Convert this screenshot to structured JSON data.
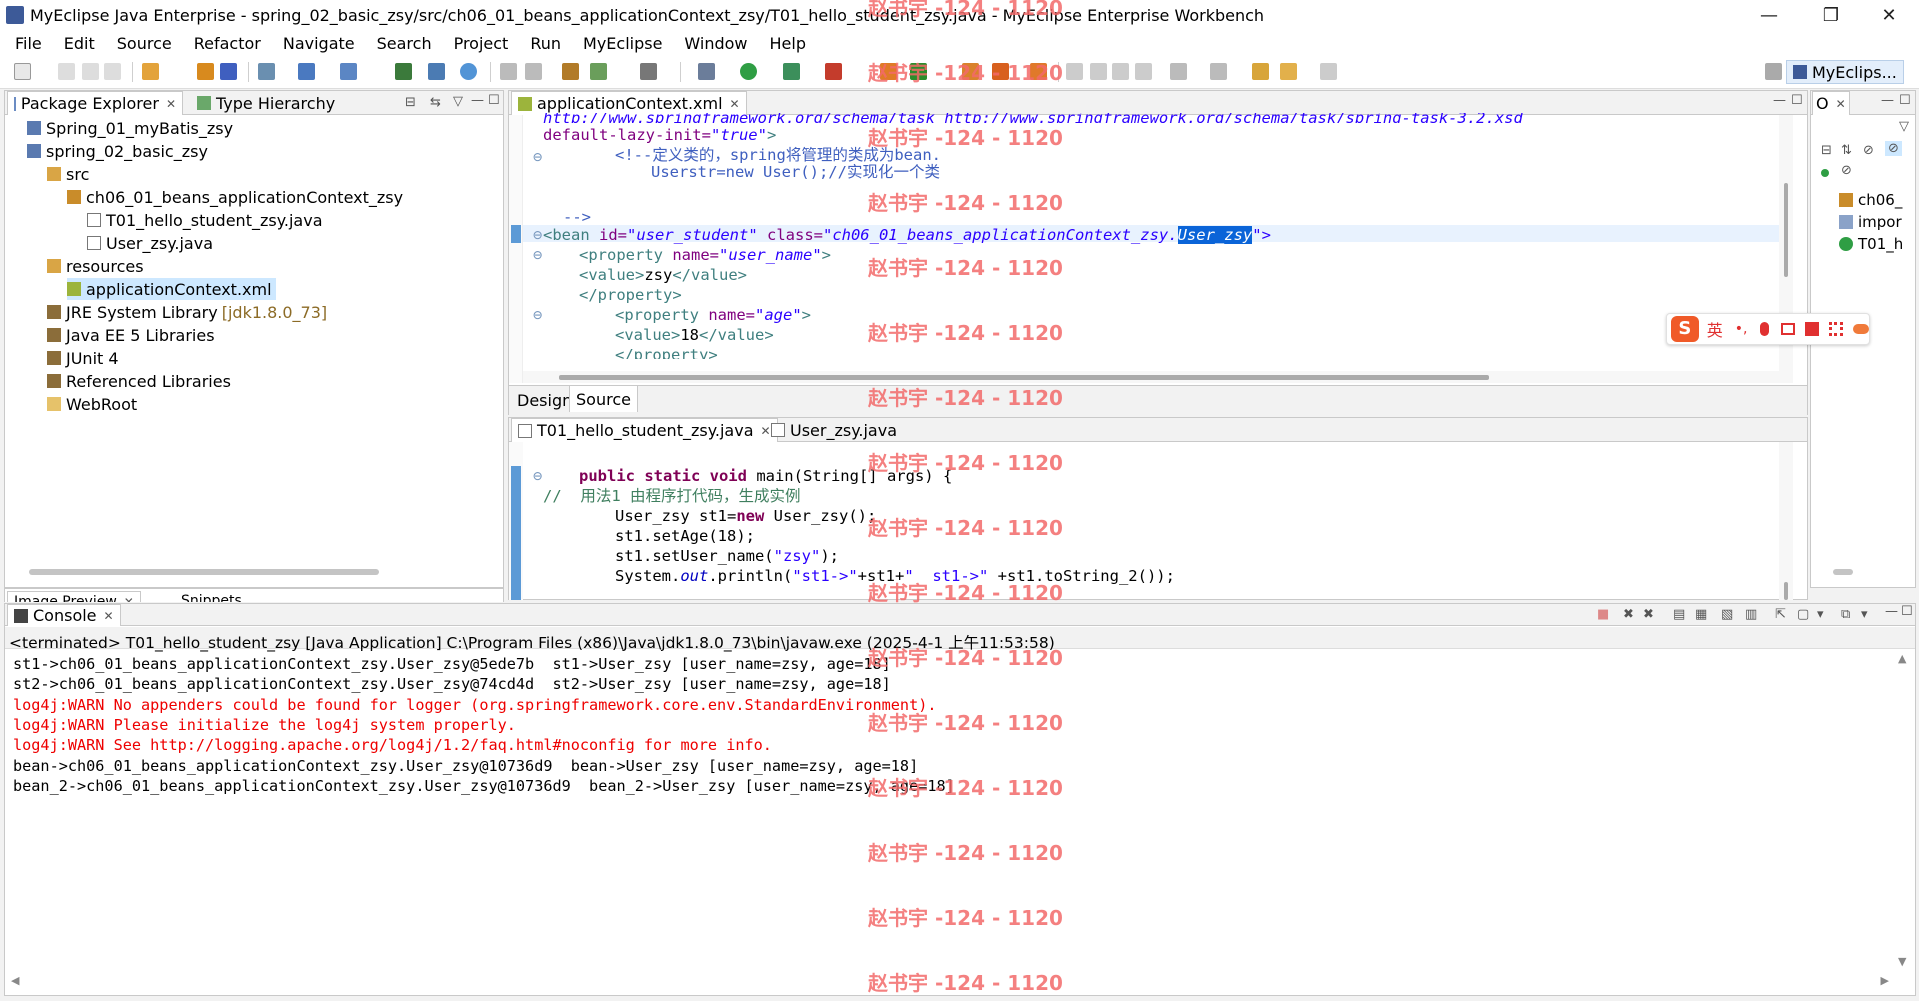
{
  "window": {
    "title": "MyEclipse Java Enterprise - spring_02_basic_zsy/src/ch06_01_beans_applicationContext_zsy/T01_hello_student_zsy.java - MyEclipse Enterprise Workbench",
    "minimize": "—",
    "restore": "❐",
    "close": "✕"
  },
  "menu": [
    "File",
    "Edit",
    "Source",
    "Refactor",
    "Navigate",
    "Search",
    "Project",
    "Run",
    "MyEclipse",
    "Window",
    "Help"
  ],
  "perspective": {
    "label": "MyEclips..."
  },
  "package_explorer": {
    "tab1": "Package Explorer",
    "tab2": "Type Hierarchy",
    "items": [
      {
        "label": "Spring_01_myBatis_zsy"
      },
      {
        "label": "spring_02_basic_zsy"
      },
      {
        "label": "src"
      },
      {
        "label": "ch06_01_beans_applicationContext_zsy"
      },
      {
        "label": "T01_hello_student_zsy.java"
      },
      {
        "label": "User_zsy.java"
      },
      {
        "label": "resources"
      },
      {
        "label": "applicationContext.xml"
      },
      {
        "label": "JRE System Library",
        "extra": "[jdk1.8.0_73]"
      },
      {
        "label": "Java EE 5 Libraries"
      },
      {
        "label": "JUnit 4"
      },
      {
        "label": "Referenced Libraries"
      },
      {
        "label": "WebRoot"
      }
    ]
  },
  "bottom_left_tabs": {
    "tab1": "Image Preview",
    "tab2": "Snippets"
  },
  "xml_editor": {
    "tab": "applicationContext.xml",
    "mode_tabs": [
      "Design",
      "Source"
    ],
    "lines": {
      "l0": "http://www.springframework.org/schema/task http://www.springframework.org/schema/task/spring-task-3.2.xsd",
      "l1a": "default-lazy-init=",
      "l1b": "\"true\"",
      "l1c": ">",
      "l2": "<!--定义类的，spring将管理的类成为bean.",
      "l3": "Userstr=new User();//实现化一个类",
      "l4": "-->",
      "l5a": "<bean",
      "l5b": " id=",
      "l5c": "\"user_student\"",
      "l5d": " class=",
      "l5e": "\"ch06_01_beans_applicationContext_zsy.",
      "l5f": "User_zsy",
      "l5g": "\">",
      "l6a": "<property",
      "l6b": " name=",
      "l6c": "\"user_name\"",
      "l6d": ">",
      "l7a": "<value>",
      "l7b": "zsy",
      "l7c": "</value>",
      "l8": "</property>",
      "l9a": "<property",
      "l9b": " name=",
      "l9c": "\"age\"",
      "l9d": ">",
      "l10a": "<value>",
      "l10b": "18",
      "l10c": "</value>",
      "l11": "</property>"
    }
  },
  "java_editor": {
    "tab1": "T01_hello_student_zsy.java",
    "tab2": "User_zsy.java",
    "lines": {
      "m1a": "public static void",
      "m1b": " main(String[] args) {",
      "m2": "//  用法1 由程序打代码，生成实例",
      "m3a": "User_zsy st1=",
      "m3b": "new",
      "m3c": " User_zsy();",
      "m4": "st1.setAge(18);",
      "m5a": "st1.setUser_name(",
      "m5b": "\"zsy\"",
      "m5c": ");",
      "m6a": "System.",
      "m6b": "out",
      "m6c": ".println(",
      "m6d": "\"st1->\"",
      "m6e": "+st1+",
      "m6f": "\"  st1->\"",
      "m6g": " +st1.toString_2());"
    }
  },
  "outline": {
    "tab": "O",
    "items": [
      "ch06_",
      "impor",
      "T01_h"
    ]
  },
  "console": {
    "tab": "Console",
    "header": "<terminated> T01_hello_student_zsy [Java Application] C:\\Program Files (x86)\\Java\\jdk1.8.0_73\\bin\\javaw.exe (2025-4-1 上午11:53:58)",
    "lines": [
      {
        "text": "st1->ch06_01_beans_applicationContext_zsy.User_zsy@5ede7b  st1->User_zsy [user_name=zsy, age=18]",
        "err": false
      },
      {
        "text": "st2->ch06_01_beans_applicationContext_zsy.User_zsy@74cd4d  st2->User_zsy [user_name=zsy, age=18]",
        "err": false
      },
      {
        "text": "log4j:WARN No appenders could be found for logger (org.springframework.core.env.StandardEnvironment).",
        "err": true
      },
      {
        "text": "log4j:WARN Please initialize the log4j system properly.",
        "err": true
      },
      {
        "text": "log4j:WARN See http://logging.apache.org/log4j/1.2/faq.html#noconfig for more info.",
        "err": true
      },
      {
        "text": "bean->ch06_01_beans_applicationContext_zsy.User_zsy@10736d9  bean->User_zsy [user_name=zsy, age=18]",
        "err": false
      },
      {
        "text": "bean_2->ch06_01_beans_applicationContext_zsy.User_zsy@10736d9  bean_2->User_zsy [user_name=zsy, age=18]",
        "err": false
      }
    ]
  },
  "ime": {
    "label": "英"
  },
  "watermark": "赵书宇 -124 - 1120"
}
